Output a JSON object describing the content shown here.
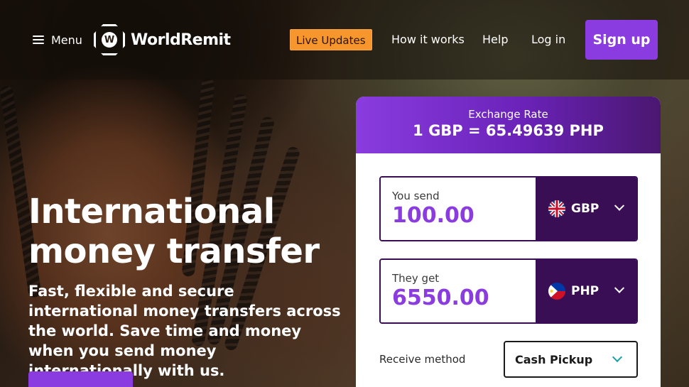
{
  "header": {
    "menu_label": "Menu",
    "brand": "WorldRemit",
    "live_updates": "Live Updates",
    "nav": [
      "How it works",
      "Help",
      "Log in"
    ],
    "signup": "Sign up"
  },
  "hero": {
    "title": "International money transfer",
    "subtitle": "Fast, flexible and secure international money transfers across the world. Save time and money when you send money internationally with us."
  },
  "calculator": {
    "rate_label": "Exchange Rate",
    "rate_value": "1 GBP = 65.49639 PHP",
    "send": {
      "label": "You send",
      "amount": "100.00",
      "currency": "GBP",
      "flag_icon": "uk-flag-icon"
    },
    "receive": {
      "label": "They get",
      "amount": "6550.00",
      "currency": "PHP",
      "flag_icon": "philippines-flag-icon"
    },
    "receive_method_label": "Receive method",
    "receive_method_value": "Cash Pickup"
  },
  "colors": {
    "brand_purple": "#8a3ce0",
    "dark_purple": "#3a0e54",
    "live_orange": "#f7962d",
    "accent_teal": "#1aa0a8"
  }
}
